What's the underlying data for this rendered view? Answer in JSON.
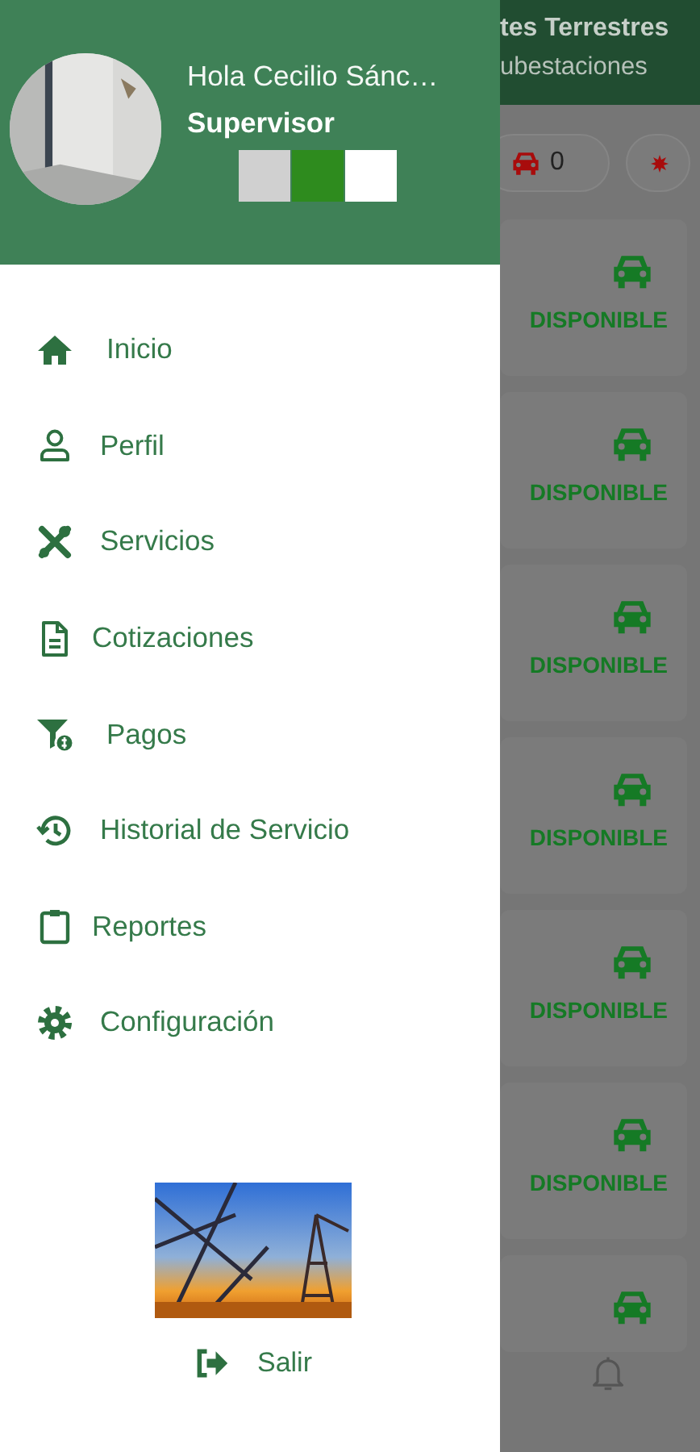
{
  "background": {
    "title": "tes Terrestres",
    "subtitle": "ubestaciones",
    "chips": [
      {
        "kind": "car",
        "count": "0"
      },
      {
        "kind": "alert"
      }
    ],
    "units": [
      {
        "kind": "car",
        "status": "DISPONIBLE"
      },
      {
        "kind": "car",
        "status": "DISPONIBLE"
      },
      {
        "kind": "car",
        "status": "DISPONIBLE"
      },
      {
        "kind": "car",
        "status": "DISPONIBLE"
      },
      {
        "kind": "car",
        "status": "DISPONIBLE"
      },
      {
        "kind": "car",
        "status": "DISPONIBLE"
      },
      {
        "kind": "car"
      }
    ]
  },
  "drawer": {
    "user": {
      "greeting": "Hola Cecilio Sánc…",
      "role": "Supervisor",
      "swatches": [
        {
          "color": "#d0d0d0"
        },
        {
          "color": "#2e8b1e"
        },
        {
          "color": "#ffffff"
        }
      ]
    },
    "menu": [
      {
        "kind": "home",
        "label": "Inicio"
      },
      {
        "kind": "user",
        "label": "Perfil"
      },
      {
        "kind": "tools",
        "label": "Servicios"
      },
      {
        "kind": "document",
        "label": "Cotizaciones"
      },
      {
        "kind": "payments",
        "label": "Pagos"
      },
      {
        "kind": "history",
        "label": "Historial de Servicio"
      },
      {
        "kind": "clipboard",
        "label": "Reportes"
      },
      {
        "kind": "gear",
        "label": "Configuración"
      }
    ],
    "logout": {
      "label": "Salir"
    }
  }
}
